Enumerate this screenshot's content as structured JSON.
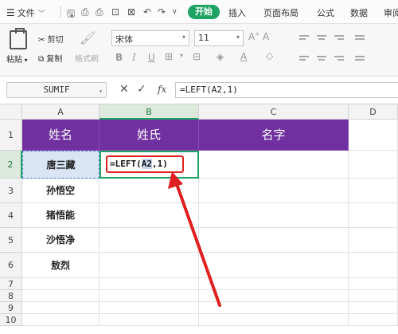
{
  "menu": {
    "file_label": "文件",
    "tabs": [
      "开始",
      "插入",
      "页面布局",
      "公式",
      "数据",
      "审阅"
    ]
  },
  "ribbon": {
    "paste": "粘贴",
    "cut": "剪切",
    "copy": "复制",
    "format_painter": "格式刷",
    "font_name": "宋体",
    "font_size": "11"
  },
  "formula_bar": {
    "name_box": "SUMIF",
    "fx": "fx",
    "formula": "=LEFT(A2,1)"
  },
  "sheet": {
    "columns": [
      "A",
      "B",
      "C",
      "D"
    ],
    "rows": [
      "1",
      "2",
      "3",
      "4",
      "5",
      "6",
      "7",
      "8",
      "9",
      "10"
    ],
    "header_row": [
      "姓名",
      "姓氏",
      "名字"
    ],
    "names": [
      "唐三藏",
      "孙悟空",
      "猪悟能",
      "沙悟净",
      "敖烈"
    ],
    "edit_cell": {
      "prefix": "=LEFT(",
      "ref": "A2",
      "suffix": ",1)"
    }
  },
  "colors": {
    "accent_green": "#1ea362",
    "header_purple": "#7030a0",
    "annotation_red": "#e02020"
  }
}
